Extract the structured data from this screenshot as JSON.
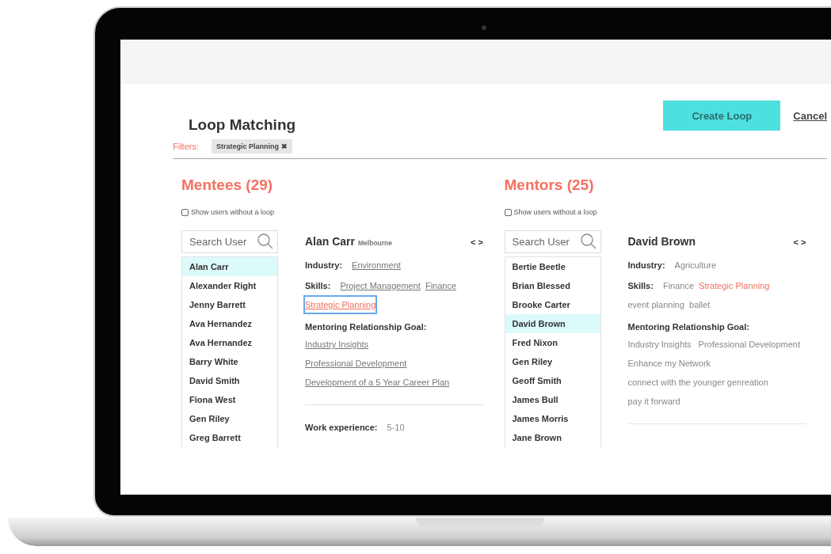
{
  "dialog": {
    "title": "Loop Matching",
    "actions": [
      {
        "label": "Create Loop",
        "kind": "primary"
      },
      {
        "label": "Cancel",
        "kind": "link"
      }
    ],
    "filters": {
      "label": "Filters:",
      "chips": [
        {
          "label": "Strategic Planning",
          "remove": "✖"
        }
      ]
    },
    "panels": [
      {
        "title": "Mentees (29)",
        "checkbox": {
          "label": "Show users without a loop",
          "checked": false
        },
        "search": {
          "placeholder": "Search User"
        },
        "users": [
          {
            "name": "Alan Carr",
            "selected": true
          },
          {
            "name": "Alexander Right",
            "selected": false
          },
          {
            "name": "Jenny Barrett",
            "selected": false
          },
          {
            "name": "Ava Hernandez",
            "selected": false
          },
          {
            "name": "Ava Hernandez",
            "selected": false
          },
          {
            "name": "Barry White",
            "selected": false
          },
          {
            "name": "David Smith",
            "selected": false
          },
          {
            "name": "Fiona West",
            "selected": false
          },
          {
            "name": "Gen Riley",
            "selected": false
          },
          {
            "name": "Greg Barrett",
            "selected": false
          }
        ],
        "profile": {
          "name": "Alan Carr",
          "location": "Melbourne",
          "nav": "< >",
          "industry": {
            "label": "Industry:",
            "values": [
              {
                "text": "Environment",
                "kind": "link"
              }
            ]
          },
          "skills": {
            "label": "Skills:",
            "values": [
              {
                "text": "Project Management",
                "kind": "link"
              },
              {
                "text": "Finance",
                "kind": "link"
              },
              {
                "text": "Strategic Planning",
                "kind": "link-focused"
              }
            ]
          },
          "goals": {
            "label": "Mentoring Relationship Goal:",
            "values": [
              {
                "text": "Industry Insights",
                "kind": "link"
              },
              {
                "text": "Professional Development",
                "kind": "link"
              },
              {
                "text": "Development of a 5 Year Career Plan",
                "kind": "link"
              }
            ]
          },
          "work_experience": {
            "label": "Work experience:",
            "value": "5-10"
          }
        }
      },
      {
        "title": "Mentors (25)",
        "checkbox": {
          "label": "Show users without a loop",
          "checked": false
        },
        "search": {
          "placeholder": "Search User"
        },
        "users": [
          {
            "name": "Bertie Beetle",
            "selected": false
          },
          {
            "name": "Brian Blessed",
            "selected": false
          },
          {
            "name": "Brooke Carter",
            "selected": false
          },
          {
            "name": "David Brown",
            "selected": true
          },
          {
            "name": "Fred Nixon",
            "selected": false
          },
          {
            "name": "Gen Riley",
            "selected": false
          },
          {
            "name": "Geoff Smith",
            "selected": false
          },
          {
            "name": "James Bull",
            "selected": false
          },
          {
            "name": "James Morris",
            "selected": false
          },
          {
            "name": "Jane Brown",
            "selected": false
          }
        ],
        "profile": {
          "name": "David Brown",
          "nav": "< >",
          "industry": {
            "label": "Industry:",
            "values": [
              {
                "text": "Agriculture",
                "kind": "plain"
              }
            ]
          },
          "skills": {
            "label": "Skills:",
            "values": [
              {
                "text": "Finance",
                "kind": "plain"
              },
              {
                "text": "Strategic Planning",
                "kind": "plain-matched"
              },
              {
                "text": "event planning",
                "kind": "plain"
              },
              {
                "text": "ballet",
                "kind": "plain"
              }
            ]
          },
          "goals": {
            "label": "Mentoring Relationship Goal:",
            "values": [
              {
                "text": "Industry Insights",
                "kind": "plain"
              },
              {
                "text": "Professional Development",
                "kind": "plain"
              },
              {
                "text": "Enhance my Network",
                "kind": "plain"
              },
              {
                "text": "connect with the younger genreation",
                "kind": "plain"
              },
              {
                "text": "pay it forward",
                "kind": "plain"
              }
            ]
          }
        }
      }
    ]
  }
}
